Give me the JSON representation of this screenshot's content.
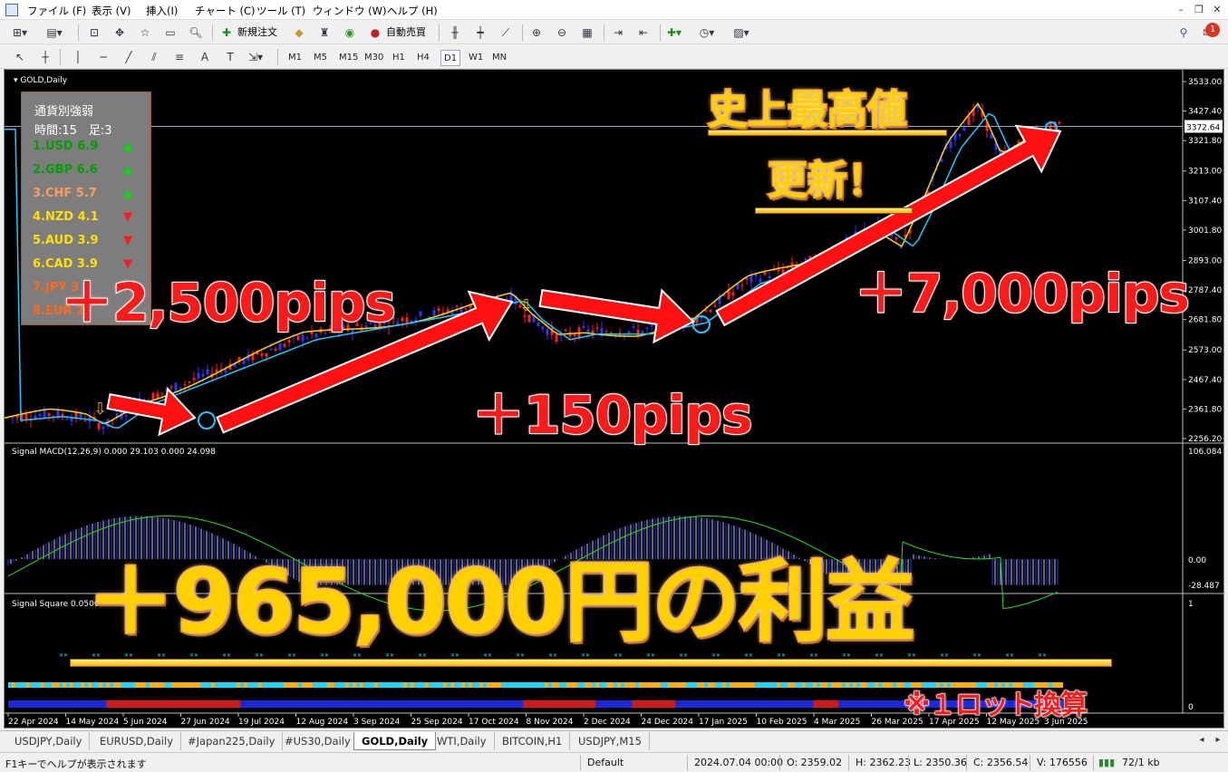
{
  "menu": {
    "items": [
      "ファイル (F)",
      "表示 (V)",
      "挿入(I)",
      "チャート (C)",
      "ツール (T)",
      "ウィンドウ (W)",
      "ヘルプ (H)"
    ]
  },
  "toolbar": {
    "new_order": "新規注文",
    "auto_trade": "自動売買",
    "timeframes": [
      "M1",
      "M5",
      "M15",
      "M30",
      "H1",
      "H4",
      "D1",
      "W1",
      "MN"
    ],
    "active_timeframe": "D1",
    "notification_count": "1"
  },
  "chart": {
    "symbol_label": "GOLD,Daily",
    "current_price": "3372.64",
    "price_ticks": [
      "3533.00",
      "3427.40",
      "3321.80",
      "3213.00",
      "3107.40",
      "3001.80",
      "2893.00",
      "2787.40",
      "2681.80",
      "2573.00",
      "2467.40",
      "2361.80",
      "2256.20"
    ],
    "macd_label": "Signal MACD(12,26,9) 0.000 29.103 0.000 24.098",
    "macd_ticks": [
      "106.084",
      "0.00",
      "-28.487"
    ],
    "square_label": "Signal Square 0.0500 0.4700 0",
    "square_ticks": [
      "1",
      "0"
    ],
    "date_ticks": [
      "22 Apr 2024",
      "14 May 2024",
      "5 Jun 2024",
      "27 Jun 2024",
      "19 Jul 2024",
      "12 Aug 2024",
      "3 Sep 2024",
      "25 Sep 2024",
      "17 Oct 2024",
      "8 Nov 2024",
      "2 Dec 2024",
      "24 Dec 2024",
      "17 Jan 2025",
      "10 Feb 2025",
      "4 Mar 2025",
      "26 Mar 2025",
      "17 Apr 2025",
      "12 May 2025",
      "3 Jun 2025"
    ]
  },
  "strength_panel": {
    "title": "通貨別強弱",
    "subtitle": "時間:15　足:3",
    "rows": [
      {
        "label": "1.USD 6.9",
        "color": "#00a000",
        "direction": "up"
      },
      {
        "label": "2.GBP 6.6",
        "color": "#00a000",
        "direction": "up"
      },
      {
        "label": "3.CHF 5.7",
        "color": "#ff9b5a",
        "direction": "up"
      },
      {
        "label": "4.NZD 4.1",
        "color": "#ffe000",
        "direction": "down"
      },
      {
        "label": "5.AUD 3.9",
        "color": "#ffe000",
        "direction": "down"
      },
      {
        "label": "6.CAD 3.9",
        "color": "#ffe000",
        "direction": "down"
      },
      {
        "label": "7.JPY 3",
        "color": "#ff6a1a",
        "direction": "down"
      },
      {
        "label": "8.EUR 2",
        "color": "#ff6a1a",
        "direction": "down"
      }
    ]
  },
  "overlays": {
    "pips_1": "＋2,500pips",
    "pips_2": "＋150pips",
    "pips_3": "＋7,000pips",
    "record_line1": "史上最高値",
    "record_line2": "更新！",
    "profit": "＋965,000円の利益",
    "note": "※１ロット換算"
  },
  "tabs": [
    "USDJPY,Daily",
    "EURUSD,Daily",
    "#Japan225,Daily",
    "#US30,Daily",
    "GOLD,Daily",
    "WTI,Daily",
    "BITCOIN,H1",
    "USDJPY,M15"
  ],
  "active_tab": "GOLD,Daily",
  "status": {
    "help": "F1キーでヘルプが表示されます",
    "profile": "Default",
    "datetime": "2024.07.04 00:00",
    "open": "O: 2359.02",
    "high": "H: 2362.23",
    "low": "L: 2350.36",
    "close": "C: 2356.54",
    "volume": "V: 176556",
    "traffic": "72/1 kb"
  },
  "colors": {
    "bull": "#2a36ff",
    "bear": "#ff2020",
    "ma_yellow": "#ffd200",
    "ma_cyan": "#1ec8ff",
    "arrow_red": "#ff1010",
    "signal_green": "#22dd22"
  }
}
